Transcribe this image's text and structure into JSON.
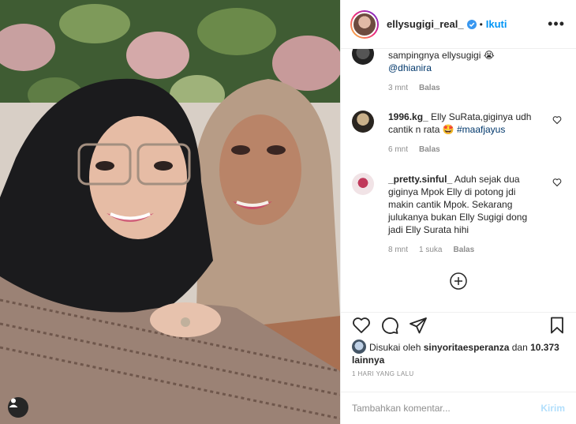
{
  "header": {
    "username": "ellysugigi_real_",
    "dot": "•",
    "follow_label": "Ikuti",
    "more": "•••"
  },
  "comments": [
    {
      "text": "sampingnya ellysugigi 😭",
      "mention": "@dhianira",
      "time": "3 mnt",
      "reply": "Balas"
    },
    {
      "user": "1996.kg_",
      "text": " Elly SuRata,giginya udh cantik n rata 🤩 ",
      "hashtag": "#maafjayus",
      "time": "6 mnt",
      "reply": "Balas"
    },
    {
      "user": "_pretty.sinful_",
      "text": " Aduh sejak dua giginya Mpok Elly di potong jdi makin cantik Mpok. Sekarang julukanya bukan Elly Sugigi dong jadi Elly Surata hihi",
      "time": "8 mnt",
      "likes": "1 suka",
      "reply": "Balas"
    }
  ],
  "likes": {
    "prefix": "Disukai oleh ",
    "user": "sinyoritaesperanza",
    "middle": " dan ",
    "count": "10.373 lainnya"
  },
  "time_ago": "1 HARI YANG LALU",
  "compose": {
    "placeholder": "Tambahkan komentar...",
    "send_label": "Kirim"
  },
  "colors": {
    "accent": "#0095f6",
    "text": "#262626",
    "muted": "#8e8e8e",
    "send_disabled": "#b2dffc",
    "border": "#efefef"
  },
  "icons": [
    "heart-icon",
    "comment-icon",
    "share-icon",
    "bookmark-icon",
    "add-circle-icon",
    "user-tag-icon",
    "verified-icon"
  ]
}
